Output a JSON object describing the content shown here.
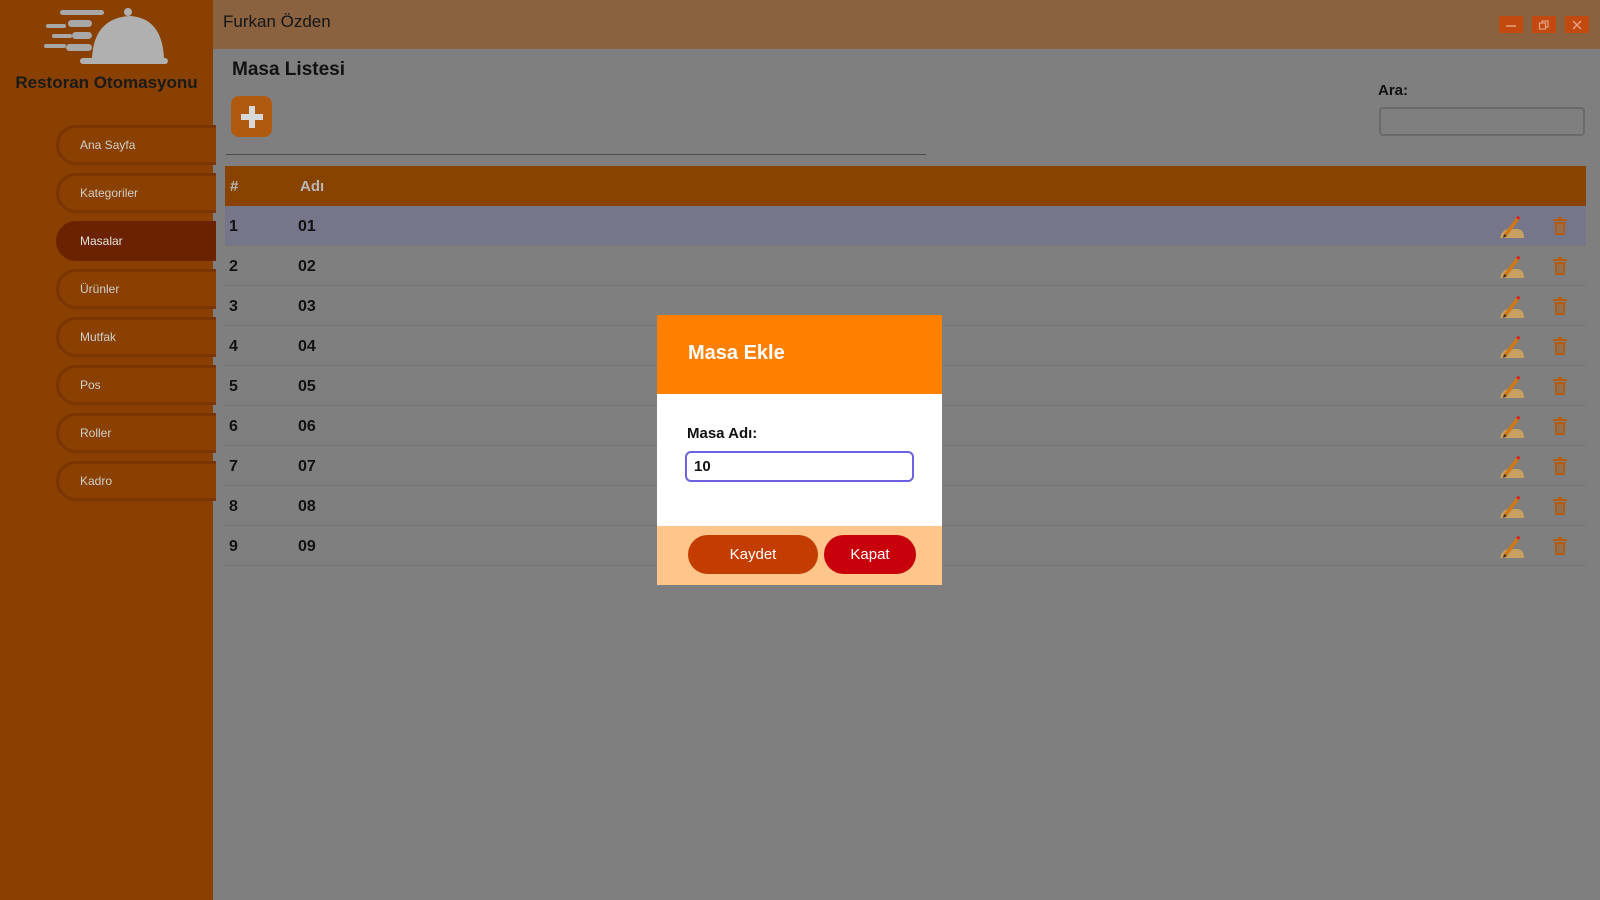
{
  "app": {
    "title": "Restoran Otomasyonu"
  },
  "window": {
    "title": "Furkan Özden"
  },
  "sidebar": {
    "items": [
      {
        "label": "Ana Sayfa",
        "active": false
      },
      {
        "label": "Kategoriler",
        "active": false
      },
      {
        "label": "Masalar",
        "active": true
      },
      {
        "label": "Ürünler",
        "active": false
      },
      {
        "label": "Mutfak",
        "active": false
      },
      {
        "label": "Pos",
        "active": false
      },
      {
        "label": "Roller",
        "active": false
      },
      {
        "label": "Kadro",
        "active": false
      }
    ]
  },
  "main": {
    "title": "Masa Listesi",
    "search": {
      "label": "Ara:",
      "value": ""
    },
    "table": {
      "columns": [
        "#",
        "Adı"
      ],
      "rows": [
        [
          "1",
          "01"
        ],
        [
          "2",
          "02"
        ],
        [
          "3",
          "03"
        ],
        [
          "4",
          "04"
        ],
        [
          "5",
          "05"
        ],
        [
          "6",
          "06"
        ],
        [
          "7",
          "07"
        ],
        [
          "8",
          "08"
        ],
        [
          "9",
          "09"
        ]
      ],
      "selected_row": 0
    }
  },
  "modal": {
    "title": "Masa Ekle",
    "field_label": "Masa Adı:",
    "field_value": "10",
    "save_label": "Kaydet",
    "close_label": "Kapat"
  },
  "colors": {
    "sidebar": "#894000",
    "titlebar": "#8b6240",
    "table_header": "#884300",
    "modal_header": "#ff7f00",
    "modal_footer": "#ffc58a",
    "save_button": "#c43d00",
    "close_button": "#c8000c"
  },
  "icons": {
    "add": "plus-icon",
    "edit": "pencil-hand-icon",
    "delete": "trash-icon",
    "logo": "serving-cloche-icon",
    "minimize": "minimize-icon",
    "maximize": "restore-icon",
    "close": "close-icon"
  }
}
